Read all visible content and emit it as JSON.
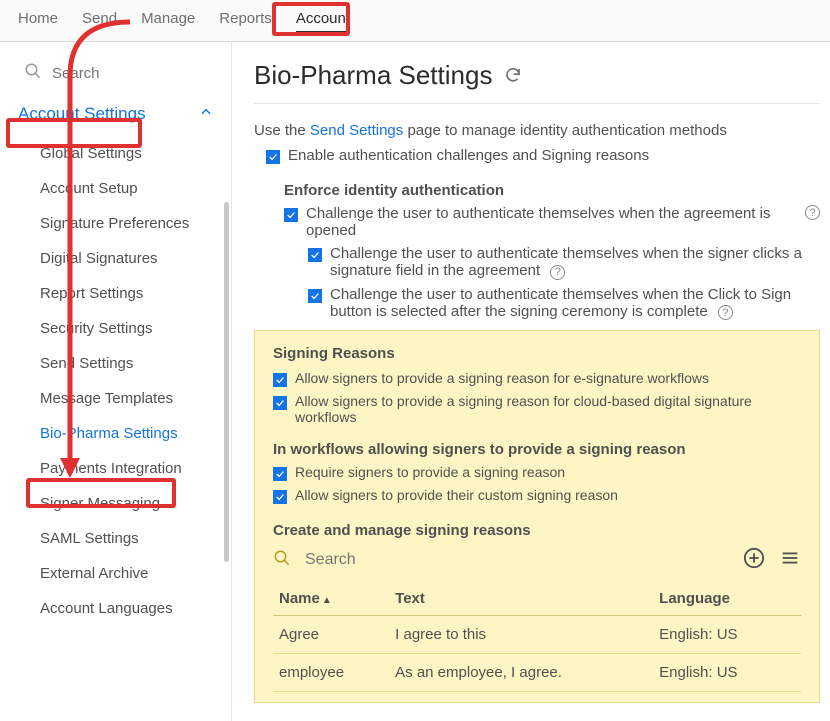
{
  "topnav": {
    "home": "Home",
    "send": "Send",
    "manage": "Manage",
    "reports": "Reports",
    "account": "Account"
  },
  "sidebar": {
    "search_placeholder": "Search",
    "section_title": "Account Settings",
    "items": [
      "Global Settings",
      "Account Setup",
      "Signature Preferences",
      "Digital Signatures",
      "Report Settings",
      "Security Settings",
      "Send Settings",
      "Message Templates",
      "Bio-Pharma Settings",
      "Payments Integration",
      "Signer Messaging",
      "SAML Settings",
      "External Archive",
      "Account Languages"
    ],
    "active_index": 8
  },
  "page": {
    "title": "Bio-Pharma Settings",
    "intro_prefix": "Use the ",
    "intro_link": "Send Settings",
    "intro_suffix": " page to manage identity authentication methods",
    "enable_auth_label": "Enable authentication challenges and Signing reasons",
    "enforce_heading": "Enforce identity authentication",
    "challenge_open": "Challenge the user to authenticate themselves when the agreement is opened",
    "challenge_sigfield": "Challenge the user to authenticate themselves when the signer clicks a signature field in the agreement",
    "challenge_clicktosign": "Challenge the user to authenticate themselves when the Click to Sign button is selected after the signing ceremony is complete"
  },
  "signing_reasons": {
    "heading": "Signing Reasons",
    "allow_esig": "Allow signers to provide a signing reason for e-signature workflows",
    "allow_cloud": "Allow signers to provide a signing reason for cloud-based digital signature workflows",
    "workflows_heading": "In workflows allowing signers to provide a signing reason",
    "require_reason": "Require signers to provide a signing reason",
    "allow_custom": "Allow signers to provide their custom signing reason",
    "create_heading": "Create and manage signing reasons",
    "search_placeholder": "Search",
    "columns": {
      "name": "Name",
      "text": "Text",
      "language": "Language"
    },
    "rows": [
      {
        "name": "Agree",
        "text": "I agree to this",
        "language": "English: US"
      },
      {
        "name": "employee",
        "text": "As an employee, I agree.",
        "language": "English: US"
      }
    ]
  }
}
